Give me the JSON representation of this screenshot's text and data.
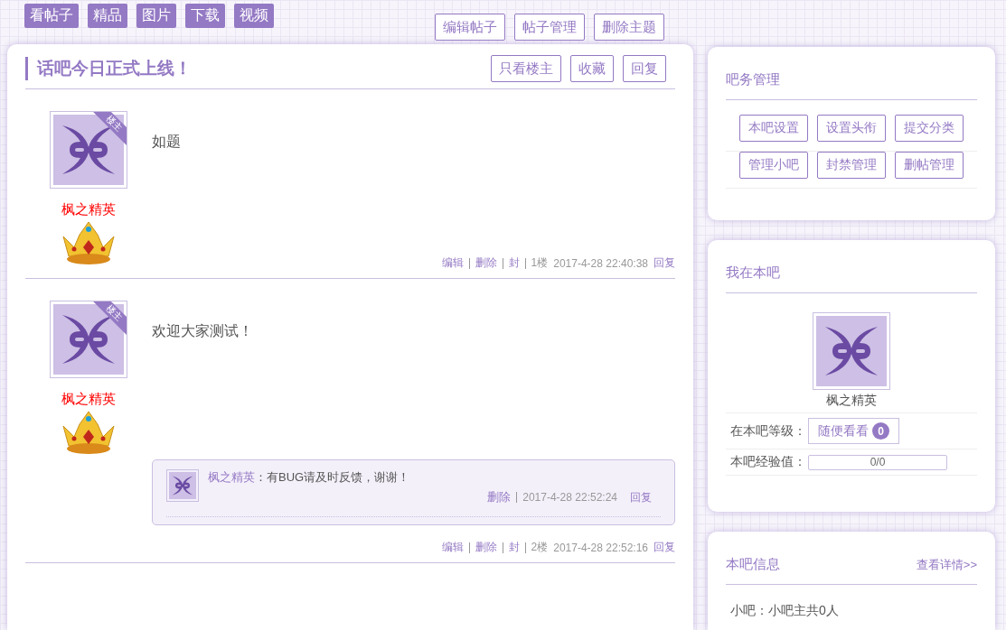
{
  "nav_tabs": [
    {
      "label": "看帖子"
    },
    {
      "label": "精品"
    },
    {
      "label": "图片"
    },
    {
      "label": "下载"
    },
    {
      "label": "视频"
    }
  ],
  "top_actions": [
    "编辑帖子",
    "帖子管理",
    "删除主题"
  ],
  "thread": {
    "title": "话吧今日正式上线！",
    "actions": [
      "只看楼主",
      "收藏",
      "回复"
    ],
    "posts": [
      {
        "badge": "楼主",
        "author": "枫之精英",
        "content": "如题",
        "actions": {
          "edit": "编辑",
          "delete": "删除",
          "ban": "封",
          "floor": "1楼",
          "time": "2017-4-28 22:40:38",
          "reply": "回复"
        }
      },
      {
        "badge": "楼主",
        "author": "枫之精英",
        "content": "欢迎大家测试！",
        "replies": [
          {
            "author": "枫之精英",
            "text": "：有BUG请及时反馈，谢谢！",
            "delete": "删除",
            "time": "2017-4-28 22:52:24",
            "reply": "回复"
          }
        ],
        "actions": {
          "edit": "编辑",
          "delete": "删除",
          "ban": "封",
          "floor": "2楼",
          "time": "2017-4-28 22:52:16",
          "reply": "回复"
        }
      }
    ]
  },
  "admin_panel": {
    "title": "吧务管理",
    "buttons": [
      "本吧设置",
      "设置头衔",
      "提交分类",
      "管理小吧",
      "封禁管理",
      "删帖管理"
    ]
  },
  "my_panel": {
    "title": "我在本吧",
    "username": "枫之精英",
    "level_label": "在本吧等级：",
    "level_name": "随便看看",
    "level_number": "0",
    "exp_label": "本吧经验值：",
    "exp": {
      "reading": "0/0",
      "level": 0
    }
  },
  "info_panel": {
    "title": "本吧信息",
    "link": "查看详情>>",
    "lines": [
      "小吧：小吧主共0人"
    ]
  }
}
